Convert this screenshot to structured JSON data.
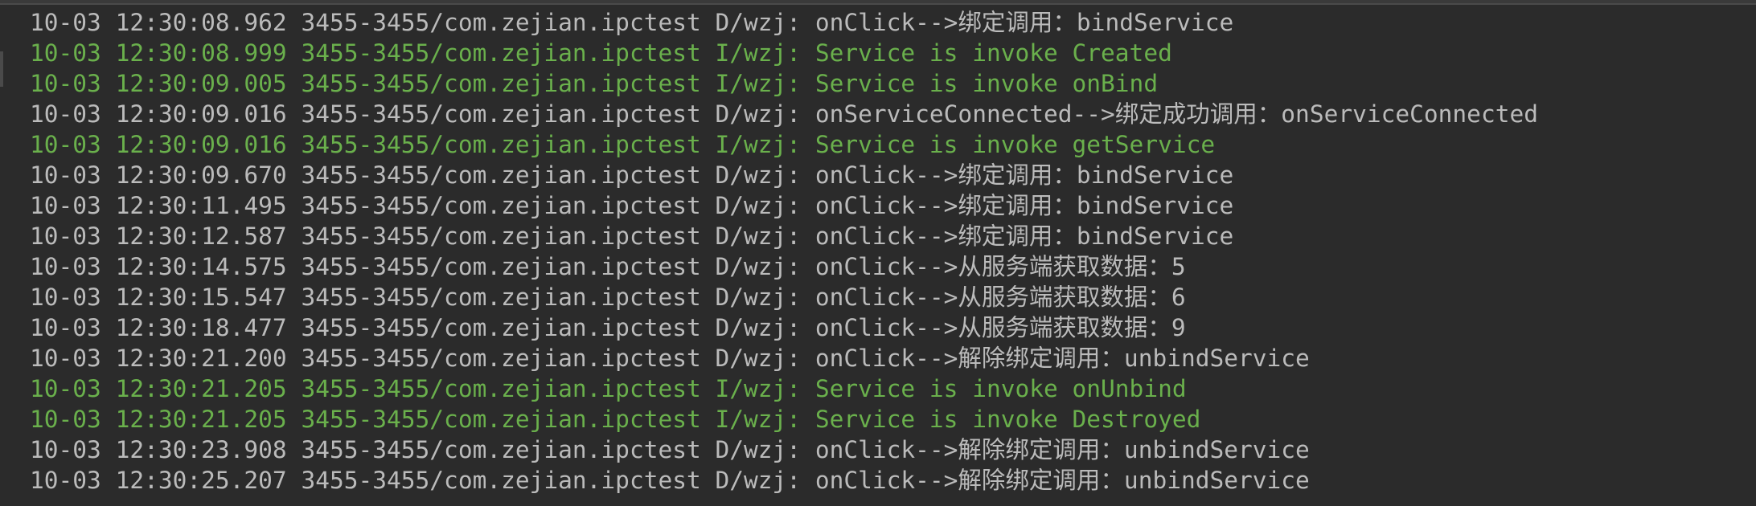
{
  "colors": {
    "background": "#2b2b2b",
    "debug_text": "#bbbbbb",
    "info_text": "#6ab04c"
  },
  "log": {
    "lines": [
      {
        "level": "D",
        "text": "10-03 12:30:08.962 3455-3455/com.zejian.ipctest D/wzj: onClick-->绑定调用：bindService"
      },
      {
        "level": "I",
        "text": "10-03 12:30:08.999 3455-3455/com.zejian.ipctest I/wzj: Service is invoke Created"
      },
      {
        "level": "I",
        "text": "10-03 12:30:09.005 3455-3455/com.zejian.ipctest I/wzj: Service is invoke onBind"
      },
      {
        "level": "D",
        "text": "10-03 12:30:09.016 3455-3455/com.zejian.ipctest D/wzj: onServiceConnected-->绑定成功调用：onServiceConnected"
      },
      {
        "level": "I",
        "text": "10-03 12:30:09.016 3455-3455/com.zejian.ipctest I/wzj: Service is invoke getService"
      },
      {
        "level": "D",
        "text": "10-03 12:30:09.670 3455-3455/com.zejian.ipctest D/wzj: onClick-->绑定调用：bindService"
      },
      {
        "level": "D",
        "text": "10-03 12:30:11.495 3455-3455/com.zejian.ipctest D/wzj: onClick-->绑定调用：bindService"
      },
      {
        "level": "D",
        "text": "10-03 12:30:12.587 3455-3455/com.zejian.ipctest D/wzj: onClick-->绑定调用：bindService"
      },
      {
        "level": "D",
        "text": "10-03 12:30:14.575 3455-3455/com.zejian.ipctest D/wzj: onClick-->从服务端获取数据：5"
      },
      {
        "level": "D",
        "text": "10-03 12:30:15.547 3455-3455/com.zejian.ipctest D/wzj: onClick-->从服务端获取数据：6"
      },
      {
        "level": "D",
        "text": "10-03 12:30:18.477 3455-3455/com.zejian.ipctest D/wzj: onClick-->从服务端获取数据：9"
      },
      {
        "level": "D",
        "text": "10-03 12:30:21.200 3455-3455/com.zejian.ipctest D/wzj: onClick-->解除绑定调用：unbindService"
      },
      {
        "level": "I",
        "text": "10-03 12:30:21.205 3455-3455/com.zejian.ipctest I/wzj: Service is invoke onUnbind"
      },
      {
        "level": "I",
        "text": "10-03 12:30:21.205 3455-3455/com.zejian.ipctest I/wzj: Service is invoke Destroyed"
      },
      {
        "level": "D",
        "text": "10-03 12:30:23.908 3455-3455/com.zejian.ipctest D/wzj: onClick-->解除绑定调用：unbindService"
      },
      {
        "level": "D",
        "text": "10-03 12:30:25.207 3455-3455/com.zejian.ipctest D/wzj: onClick-->解除绑定调用：unbindService"
      }
    ]
  }
}
